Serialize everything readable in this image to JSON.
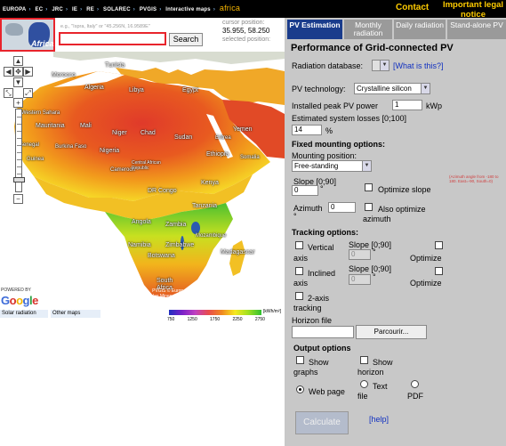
{
  "topbar": {
    "breadcrumb": [
      "EUROPA",
      "EC",
      "JRC",
      "IE",
      "RE",
      "SOLAREC",
      "PVGIS",
      "Interactive maps"
    ],
    "current": "africa",
    "contact": "Contact",
    "legal": "Important legal notice"
  },
  "map_header": {
    "region_label": "Africa",
    "search_hint": "e.g., \"Ispra, Italy\" or \"45.256N, 16.9589E\"",
    "search_value": "",
    "search_button": "Search",
    "cursor_label": "cursor position:",
    "cursor_value": "35.955, 58.250",
    "selected_label": "selected position:"
  },
  "map": {
    "labels": [
      "Morocco",
      "Algeria",
      "Libya",
      "Egypt",
      "Tunisia",
      "Western Sahara",
      "Mauritania",
      "Mali",
      "Niger",
      "Chad",
      "Sudan",
      "Yemen",
      "Eritrea",
      "Senegal",
      "Guinea",
      "Burkina Faso",
      "Nigeria",
      "Ethiopia",
      "Somalia",
      "Cameroon",
      "Central African Republic",
      "DR Congo",
      "Kenya",
      "Tanzania",
      "Angola",
      "Zambia",
      "Namibia",
      "Zimbabwe",
      "Botswana",
      "Madagascar",
      "Mozambique",
      "South Africa"
    ],
    "powered_by": "POWERED BY",
    "google": "Google",
    "copyright": "PVGIS © European Communities 2001-2007, HelioClim-1 © Ecole des Mines de Paris/Armines 2001-2007, Données cartographiques ©2011 Tele Atlas - Conditions d'utilisation",
    "tabs": [
      "Solar radiation",
      "Other maps"
    ],
    "legend_ticks": [
      "750",
      "1250",
      "1750",
      "2250",
      "2750"
    ],
    "legend_unit": "[kWh/m²]"
  },
  "panel": {
    "tabs": [
      "PV Estimation",
      "Monthly radiation",
      "Daily radiation",
      "Stand-alone PV"
    ],
    "title": "Performance of Grid-connected PV",
    "radiation_db_label": "Radiation database:",
    "radiation_db_link": "[What is this?]",
    "pv_tech_label": "PV technology:",
    "pv_tech_value": "Crystalline silicon",
    "peak_power_label": "Installed peak PV power",
    "peak_power_value": "1",
    "peak_power_unit": "kWp",
    "losses_label": "Estimated system losses [0;100]",
    "losses_value": "14",
    "losses_unit": "%",
    "fixed_heading": "Fixed mounting options:",
    "mounting_label": "Mounting position:",
    "mounting_value": "Free-standing",
    "slope_label": "Slope [0;90]",
    "slope_value": "0",
    "deg": "°",
    "optimize_slope": "Optimize slope",
    "azimuth_note": "(Azimuth angle from -180 to 180. East=-90, South=0)",
    "azimuth_label": "Azimuth",
    "azimuth_value": "0",
    "also_optimize_1": "Also optimize",
    "also_optimize_2": "azimuth",
    "tracking_heading": "Tracking options:",
    "vertical_1": "Vertical",
    "vertical_2": "axis",
    "inclined_1": "Inclined",
    "inclined_2": "axis",
    "two_axis_1": "2-axis",
    "two_axis_2": "tracking",
    "track_slope_label": "Slope [0;90]",
    "track_slope_value": "0",
    "optimize": "Optimize",
    "horizon_label": "Horizon file",
    "browse_button": "Parcourir...",
    "output_heading": "Output options",
    "show_graphs_1": "Show",
    "show_graphs_2": "graphs",
    "show_horizon_1": "Show",
    "show_horizon_2": "horizon",
    "web_page": "Web page",
    "text_file_1": "Text",
    "text_file_2": "file",
    "pdf": "PDF",
    "calculate": "Calculate",
    "help": "[help]"
  }
}
